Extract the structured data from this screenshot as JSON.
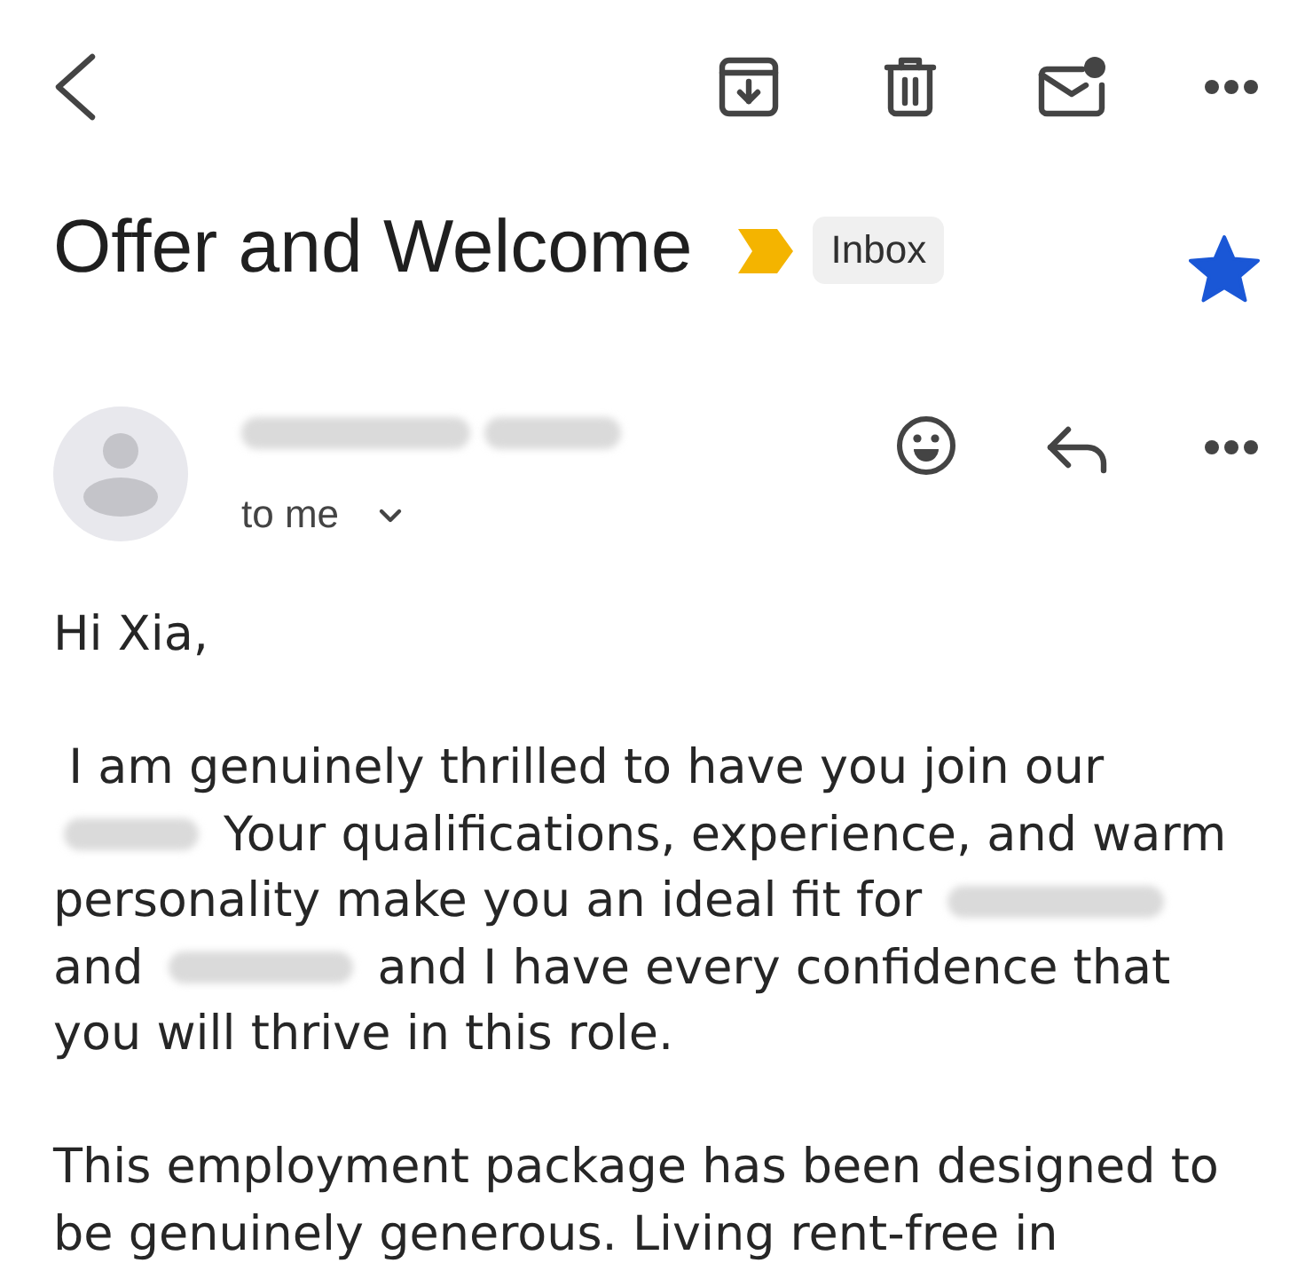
{
  "message": {
    "subject": "Offer and Welcome",
    "important": true,
    "labels": [
      "Inbox"
    ],
    "starred": true
  },
  "sender": {
    "name": {
      "kind": "redacted"
    },
    "recipients": "to me"
  },
  "body": {
    "paragraphs": [
      {
        "lines": [
          [
            {
              "kind": "text",
              "text": "Hi Xia,"
            }
          ]
        ]
      },
      {
        "lines": [
          [
            {
              "kind": "text",
              "text": " I am genuinely thrilled to have you join our"
            }
          ],
          [
            {
              "kind": "redacted"
            },
            {
              "kind": "text",
              "text": "Your qualifications, experience, and warm"
            }
          ],
          [
            {
              "kind": "text",
              "text": "personality make you an ideal fit for"
            },
            {
              "kind": "redacted"
            }
          ],
          [
            {
              "kind": "text",
              "text": "and"
            },
            {
              "kind": "redacted"
            },
            {
              "kind": "text",
              "text": "and I have every confidence that"
            }
          ],
          [
            {
              "kind": "text",
              "text": "you will thrive in this role."
            }
          ]
        ]
      },
      {
        "lines": [
          [
            {
              "kind": "text",
              "text": "This employment package has been designed to"
            }
          ],
          [
            {
              "kind": "text",
              "text": "be genuinely generous. Living rent-free in"
            }
          ]
        ]
      }
    ]
  }
}
